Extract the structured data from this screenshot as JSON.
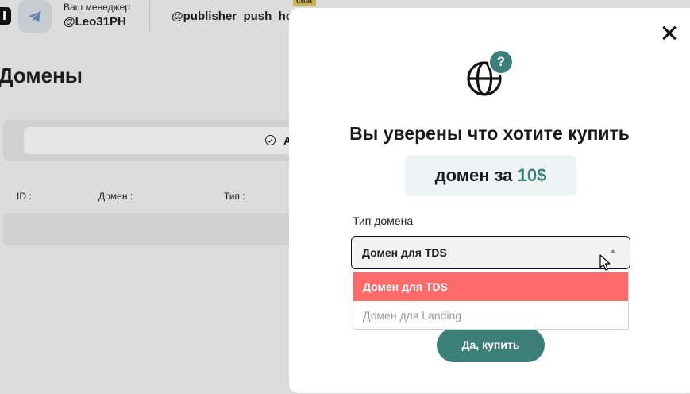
{
  "header": {
    "manager_label": "Ваш менеджер",
    "manager_name": "@Leo31PH",
    "bot_name": "@publisher_push_ho",
    "chat_badge": "chat"
  },
  "page": {
    "title": "Домены",
    "filter_letter": "А",
    "columns": [
      "ID :",
      "Домен :",
      "Тип :"
    ]
  },
  "modal": {
    "title": "Вы уверены что хотите купить",
    "price_text": "домен за",
    "price_value": "10$",
    "field_label": "Тип домена",
    "select_value": "Домен для TDS",
    "options": [
      "Домен для TDS",
      "Домен для Landing"
    ],
    "confirm_button": "Да, купить",
    "question_mark": "?"
  },
  "colors": {
    "accent": "#3b7f78",
    "highlight": "#ff6b6b"
  }
}
